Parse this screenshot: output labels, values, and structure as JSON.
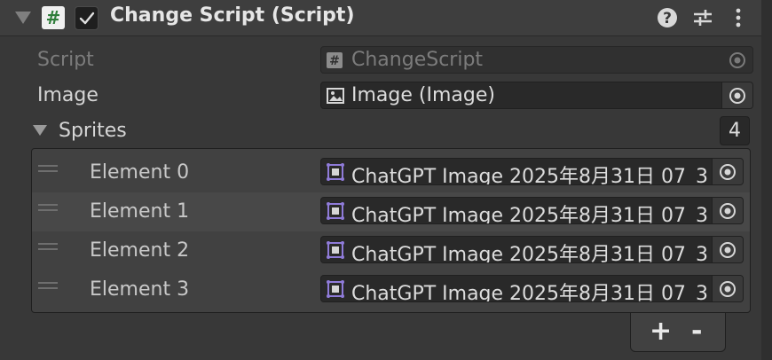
{
  "component": {
    "title": "Change Script (Script)",
    "enabled": true
  },
  "icons": {
    "component_icon": "hash-icon",
    "help": "help-icon",
    "presets": "sliders-icon",
    "menu": "kebab-icon"
  },
  "fields": {
    "script": {
      "label": "Script",
      "value": "ChangeScript"
    },
    "image": {
      "label": "Image",
      "value": "Image (Image)"
    },
    "sprites": {
      "label": "Sprites",
      "size": "4",
      "elements": [
        {
          "label": "Element 0",
          "value": "ChatGPT Image 2025年8月31日 07_3"
        },
        {
          "label": "Element 1",
          "value": "ChatGPT Image 2025年8月31日 07_3"
        },
        {
          "label": "Element 2",
          "value": "ChatGPT Image 2025年8月31日 07_3"
        },
        {
          "label": "Element 3",
          "value": "ChatGPT Image 2025年8月31日 07_3"
        }
      ]
    }
  },
  "footer": {
    "add": "+",
    "remove": "-"
  },
  "colors": {
    "background": "#383838",
    "header": "#3e3e3e",
    "field": "#292929",
    "sprite_icon": "#8f7bd9"
  }
}
